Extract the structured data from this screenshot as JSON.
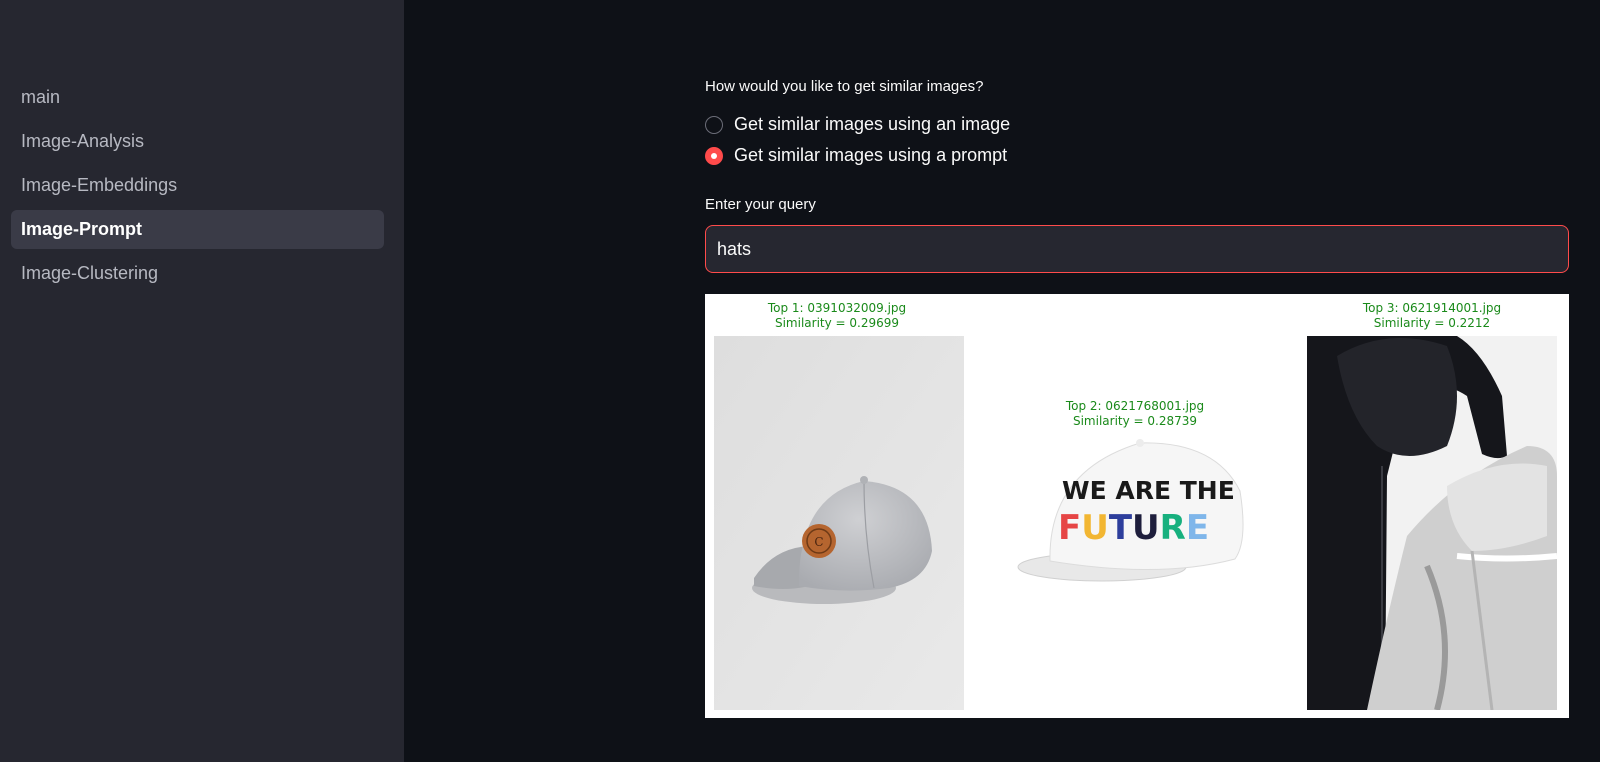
{
  "sidebar": {
    "items": [
      {
        "label": "main",
        "active": false
      },
      {
        "label": "Image-Analysis",
        "active": false
      },
      {
        "label": "Image-Embeddings",
        "active": false
      },
      {
        "label": "Image-Prompt",
        "active": true
      },
      {
        "label": "Image-Clustering",
        "active": false
      }
    ]
  },
  "form": {
    "question": "How would you like to get similar images?",
    "options": [
      {
        "label": "Get similar images using an image",
        "selected": false
      },
      {
        "label": "Get similar images using a prompt",
        "selected": true
      }
    ],
    "query_label": "Enter your query",
    "query_value": "hats"
  },
  "results": [
    {
      "title": "Top 1: 0391032009.jpg",
      "similarity": "Similarity = 0.29699"
    },
    {
      "title": "Top 2: 0621768001.jpg",
      "similarity": "Similarity = 0.28739"
    },
    {
      "title": "Top 3: 0621914001.jpg",
      "similarity": "Similarity = 0.2212"
    }
  ],
  "hat_print": {
    "line1": "WE ARE THE",
    "line2": [
      "F",
      "U",
      "T",
      "U",
      "R",
      "E"
    ]
  },
  "colors": {
    "accent": "#ff4b4b",
    "background": "#0e1117",
    "sidebar": "#262730",
    "caption": "#1a8a1a",
    "future_letters": [
      "#e64545",
      "#f2b632",
      "#2d3e9c",
      "#1e1e3c",
      "#17b07e",
      "#7fb6ea"
    ]
  }
}
